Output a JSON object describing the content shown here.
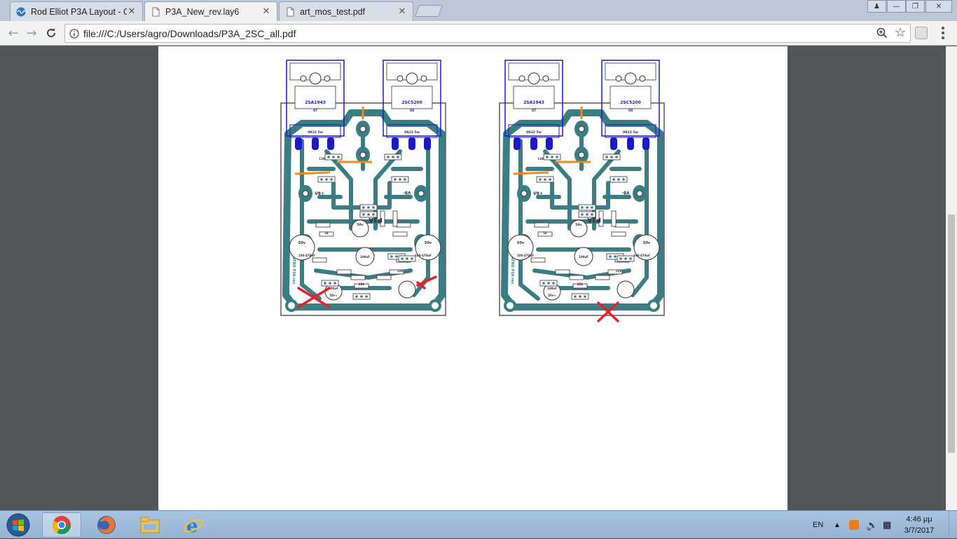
{
  "tabs": [
    {
      "title": "Rod Elliot P3A Layout - C",
      "icon": "elliott-favicon-icon",
      "active": false
    },
    {
      "title": "P3A_New_rev.lay6",
      "icon": "document-icon",
      "active": true
    },
    {
      "title": "art_mos_test.pdf",
      "icon": "document-icon",
      "active": false
    }
  ],
  "toolbar": {
    "url": "file:///C:/Users/agro/Downloads/P3A_2SC_all.pdf"
  },
  "pcb": {
    "transistor_left": "2SA1943",
    "transistor_right": "2SC5200",
    "q_left": "Q7",
    "q_right": "Q8",
    "resistor_value": "0R22 5w",
    "cap_value": "50v",
    "cap_value_big": "100uF",
    "cap_bottom": "50v+",
    "cap_label_470": "100-470uF",
    "vref_neg": "V8-",
    "vref_pos": "V8+",
    "brand": "P3A",
    "board_text": "ATRO P3A rev",
    "r22k": "22k",
    "r1k": "1k",
    "r120r": "120R"
  },
  "marks": {
    "color": "#e8202a"
  },
  "colors": {
    "trace": "#3a7d82",
    "outline": "#3a2a3a",
    "heatsink": "#1a1acc",
    "jumper": "#f08a1a"
  },
  "taskbar": {
    "lang": "EN",
    "time": "4:46 μμ",
    "date": "3/7/2017"
  }
}
